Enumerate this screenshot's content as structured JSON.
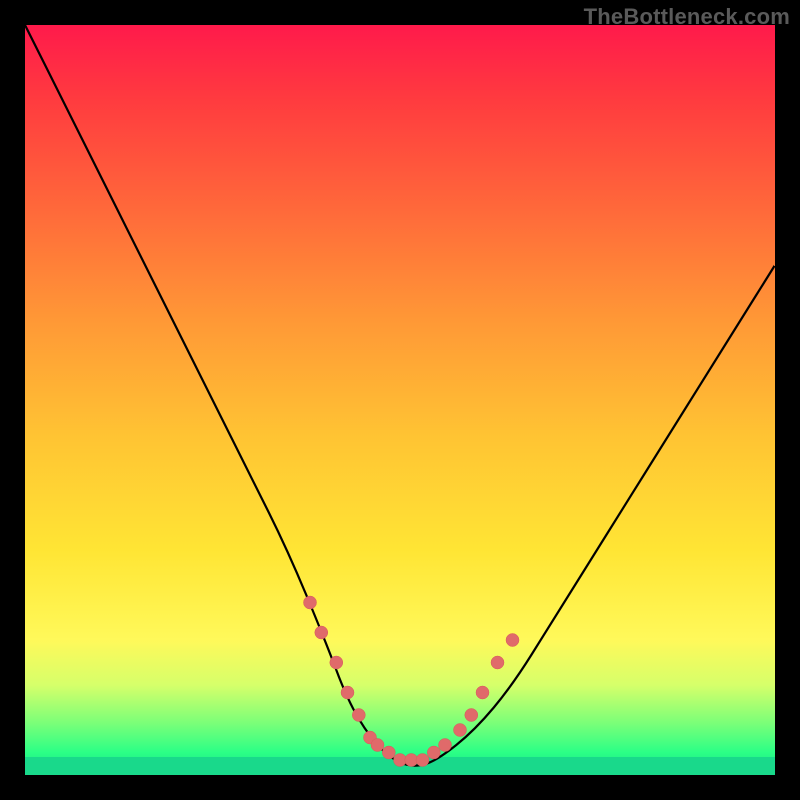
{
  "watermark": "TheBottleneck.com",
  "colors": {
    "curve": "#000000",
    "dot": "#e06a6a",
    "gradient_top": "#ff1a4b",
    "gradient_bottom": "#17e08a"
  },
  "chart_data": {
    "type": "line",
    "title": "",
    "xlabel": "",
    "ylabel": "",
    "xlim": [
      0,
      100
    ],
    "ylim": [
      0,
      100
    ],
    "series": [
      {
        "name": "bottleneck-curve",
        "x": [
          0,
          5,
          10,
          15,
          20,
          25,
          30,
          35,
          40,
          43,
          46,
          49,
          52,
          55,
          60,
          65,
          70,
          75,
          80,
          85,
          90,
          95,
          100
        ],
        "y": [
          100,
          90,
          80,
          70,
          60,
          50,
          40,
          30,
          18,
          10,
          5,
          2,
          1,
          2,
          6,
          12,
          20,
          28,
          36,
          44,
          52,
          60,
          68
        ]
      }
    ],
    "points": {
      "name": "measured-points",
      "x": [
        38.0,
        39.5,
        41.5,
        43.0,
        44.5,
        46.0,
        47.0,
        48.5,
        50.0,
        51.5,
        53.0,
        54.5,
        56.0,
        58.0,
        59.5,
        61.0,
        63.0,
        65.0
      ],
      "y": [
        23.0,
        19.0,
        15.0,
        11.0,
        8.0,
        5.0,
        4.0,
        3.0,
        2.0,
        2.0,
        2.0,
        3.0,
        4.0,
        6.0,
        8.0,
        11.0,
        15.0,
        18.0
      ]
    }
  }
}
